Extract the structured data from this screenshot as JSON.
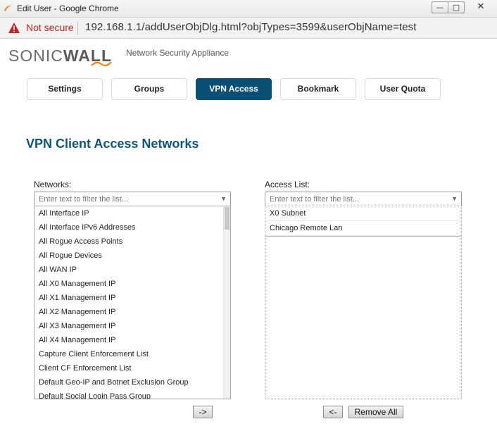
{
  "window": {
    "title": "Edit User - Google Chrome",
    "controls": {
      "minimize": "—",
      "maximize": "□",
      "close": "✕"
    }
  },
  "address_bar": {
    "security_label": "Not secure",
    "url": "192.168.1.1/addUserObjDlg.html?objTypes=3599&userObjName=test"
  },
  "brand": {
    "logo_regular": "SONIC",
    "logo_bold": "WALL",
    "subtitle": "Network Security Appliance",
    "accent_color": "#f58220"
  },
  "tabs": [
    {
      "label": "Settings",
      "active": false
    },
    {
      "label": "Groups",
      "active": false
    },
    {
      "label": "VPN Access",
      "active": true
    },
    {
      "label": "Bookmark",
      "active": false
    },
    {
      "label": "User Quota",
      "active": false
    }
  ],
  "section": {
    "title": "VPN Client Access Networks"
  },
  "networks": {
    "label": "Networks:",
    "filter_placeholder": "Enter text to filter the list...",
    "items": [
      "All Interface IP",
      "All Interface IPv6 Addresses",
      "All Rogue Access Points",
      "All Rogue Devices",
      "All WAN IP",
      "All X0 Management IP",
      "All X1 Management IP",
      "All X2 Management IP",
      "All X3 Management IP",
      "All X4 Management IP",
      "Capture Client Enforcement List",
      "Client CF Enforcement List",
      "Default Geo-IP and Botnet Exclusion Group",
      "Default Social Login Pass Group"
    ]
  },
  "access_list": {
    "label": "Access List:",
    "filter_placeholder": "Enter text to filter the list...",
    "items": [
      "X0 Subnet",
      "Chicago Remote Lan"
    ]
  },
  "buttons": {
    "add": "->",
    "remove": "<-",
    "remove_all": "Remove All"
  },
  "colors": {
    "active_tab": "#0a4f74",
    "section_title": "#0e5679",
    "not_secure": "#c5221f"
  }
}
